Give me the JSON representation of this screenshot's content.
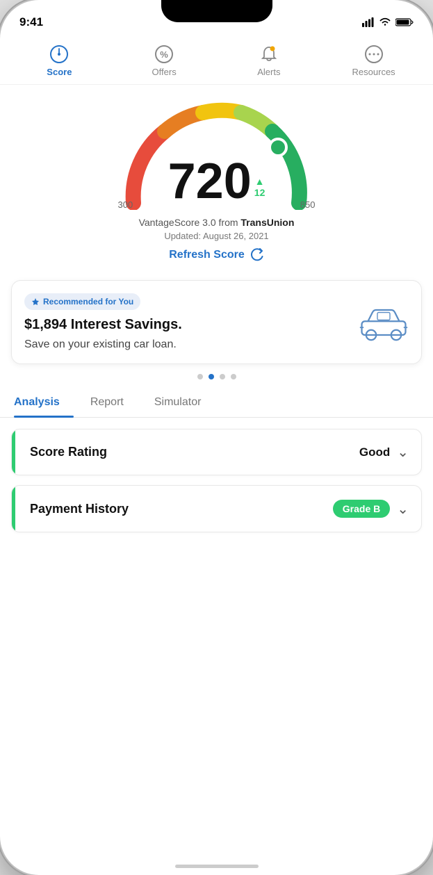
{
  "status_bar": {
    "time": "9:41"
  },
  "nav": {
    "tabs": [
      {
        "id": "score",
        "label": "Score",
        "active": true
      },
      {
        "id": "offers",
        "label": "Offers",
        "active": false
      },
      {
        "id": "alerts",
        "label": "Alerts",
        "active": false
      },
      {
        "id": "resources",
        "label": "Resources",
        "active": false
      }
    ]
  },
  "score": {
    "value": "720",
    "delta": "12",
    "min": "300",
    "max": "850",
    "source": "VantageScore 3.0 from",
    "source_provider": "TransUnion",
    "updated_label": "Updated: August 26, 2021",
    "refresh_label": "Refresh Score"
  },
  "card": {
    "badge_label": "Recommended for You",
    "title": "$1,894 Interest Savings.",
    "subtitle": "Save on your existing car loan."
  },
  "carousel": {
    "dots": [
      false,
      true,
      false,
      false
    ]
  },
  "analysis": {
    "tabs": [
      {
        "id": "analysis",
        "label": "Analysis",
        "active": true
      },
      {
        "id": "report",
        "label": "Report",
        "active": false
      },
      {
        "id": "simulator",
        "label": "Simulator",
        "active": false
      }
    ],
    "items": [
      {
        "id": "score-rating",
        "label": "Score Rating",
        "value": "Good",
        "show_badge": false
      },
      {
        "id": "payment-history",
        "label": "Payment History",
        "value": "Grade B",
        "show_badge": true
      }
    ]
  }
}
